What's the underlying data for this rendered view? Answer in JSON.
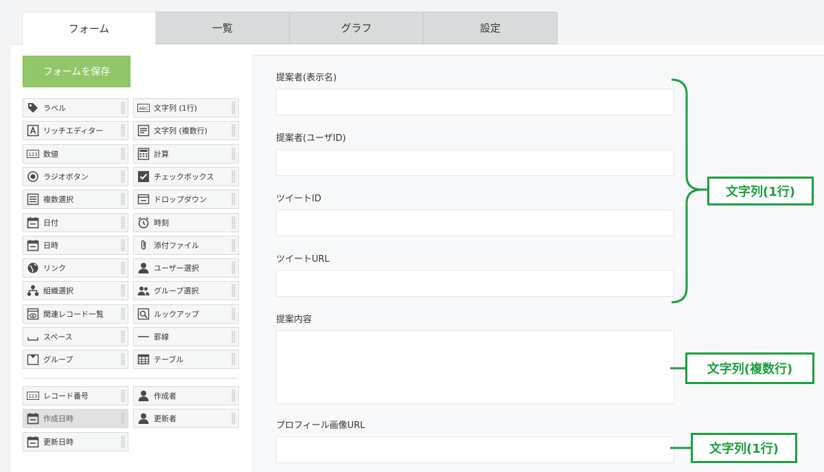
{
  "tabs": [
    "フォーム",
    "一覧",
    "グラフ",
    "設定"
  ],
  "save_button": "フォームを保存",
  "palette": {
    "left": [
      {
        "label": "ラベル",
        "icon": "tag-icon"
      },
      {
        "label": "リッチエディター",
        "icon": "rich-editor-icon"
      },
      {
        "label": "数値",
        "icon": "number-icon"
      },
      {
        "label": "ラジオボタン",
        "icon": "radio-icon"
      },
      {
        "label": "複数選択",
        "icon": "multi-select-icon"
      },
      {
        "label": "日付",
        "icon": "calendar-icon"
      },
      {
        "label": "日時",
        "icon": "calendar-icon"
      },
      {
        "label": "リンク",
        "icon": "globe-icon"
      },
      {
        "label": "組織選択",
        "icon": "org-icon"
      },
      {
        "label": "関連レコード一覧",
        "icon": "related-records-icon"
      },
      {
        "label": "スペース",
        "icon": "space-icon"
      },
      {
        "label": "グループ",
        "icon": "group-field-icon"
      }
    ],
    "right": [
      {
        "label": "文字列 (1行)",
        "icon": "abc-icon",
        "badge": "ABC"
      },
      {
        "label": "文字列 (複数行)",
        "icon": "multiline-text-icon"
      },
      {
        "label": "計算",
        "icon": "calculator-icon"
      },
      {
        "label": "チェックボックス",
        "icon": "checkbox-icon"
      },
      {
        "label": "ドロップダウン",
        "icon": "dropdown-icon"
      },
      {
        "label": "時刻",
        "icon": "clock-icon"
      },
      {
        "label": "添付ファイル",
        "icon": "paperclip-icon"
      },
      {
        "label": "ユーザー選択",
        "icon": "user-icon"
      },
      {
        "label": "グループ選択",
        "icon": "users-icon"
      },
      {
        "label": "ルックアップ",
        "icon": "lookup-icon"
      },
      {
        "label": "罫線",
        "icon": "line-icon"
      },
      {
        "label": "テーブル",
        "icon": "table-icon"
      }
    ],
    "system_left": [
      {
        "label": "レコード番号",
        "icon": "number-icon"
      },
      {
        "label": "作成日時",
        "icon": "calendar-icon",
        "disabled": true
      },
      {
        "label": "更新日時",
        "icon": "calendar-icon"
      }
    ],
    "system_right": [
      {
        "label": "作成者",
        "icon": "user-icon"
      },
      {
        "label": "更新者",
        "icon": "user-icon"
      }
    ],
    "number_badge": "123"
  },
  "fields": [
    {
      "label": "提案者(表示名)",
      "type": "text"
    },
    {
      "label": "提案者(ユーザID)",
      "type": "text"
    },
    {
      "label": "ツイートID",
      "type": "text"
    },
    {
      "label": "ツイートURL",
      "type": "text"
    },
    {
      "label": "提案内容",
      "type": "textarea"
    },
    {
      "label": "プロフィール画像URL",
      "type": "text"
    }
  ],
  "annotations": [
    "文字列(1行)",
    "文字列(複数行)",
    "文字列(1行)"
  ],
  "colors": {
    "accent_green": "#1a9f3e",
    "save_button": "#91c768"
  }
}
